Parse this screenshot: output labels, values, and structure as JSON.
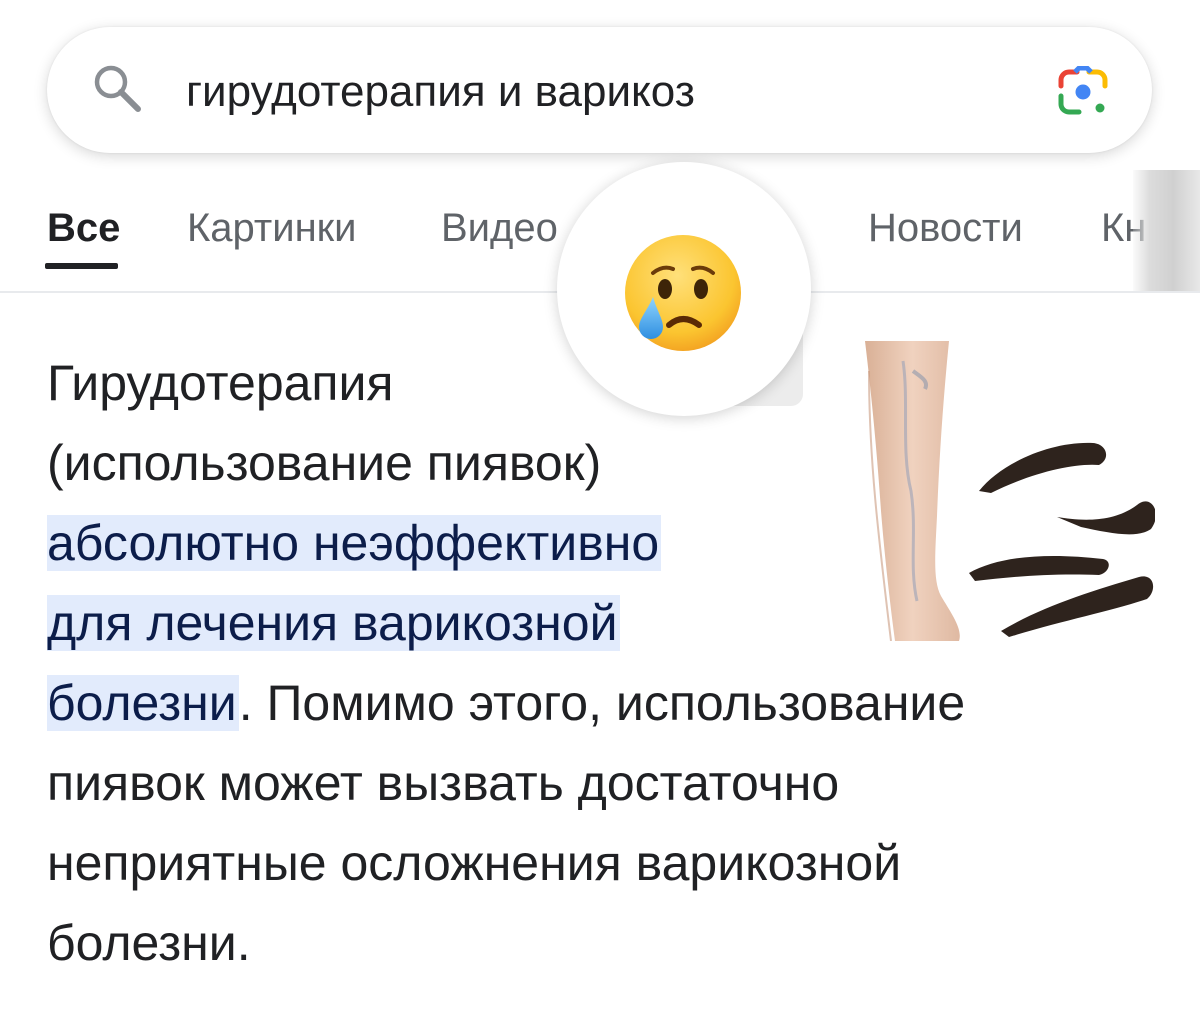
{
  "search": {
    "query": "гирудотерапия и варикоз",
    "search_icon": "search-icon",
    "lens_icon": "google-lens-camera-icon"
  },
  "tabs": [
    {
      "label": "Все",
      "active": true
    },
    {
      "label": "Картинки",
      "active": false
    },
    {
      "label": "Видео",
      "active": false
    },
    {
      "label": "Новости",
      "active": false
    },
    {
      "label": "Книг",
      "active": false
    }
  ],
  "overlay": {
    "emoji": "crying-face-emoji"
  },
  "answer": {
    "line1": "Гирудотерапия",
    "line2": "(использование пиявок)",
    "line3_highlight": "абсолютно неэффективно",
    "line4_highlight": "для лечения варикозной",
    "line5_highlight": "болезни",
    "line5_rest": ". Помимо этого, использование",
    "line6": "пиявок может вызвать достаточно",
    "line7": "неприятные осложнения варикозной",
    "line8": "болезни."
  },
  "thumbnail": {
    "subject": "leg-with-varicose-veins-and-leeches"
  },
  "colors": {
    "highlight_bg": "#e2ebfc",
    "highlight_text": "#0c1d4a",
    "text": "#202124",
    "muted": "#5f6368"
  }
}
